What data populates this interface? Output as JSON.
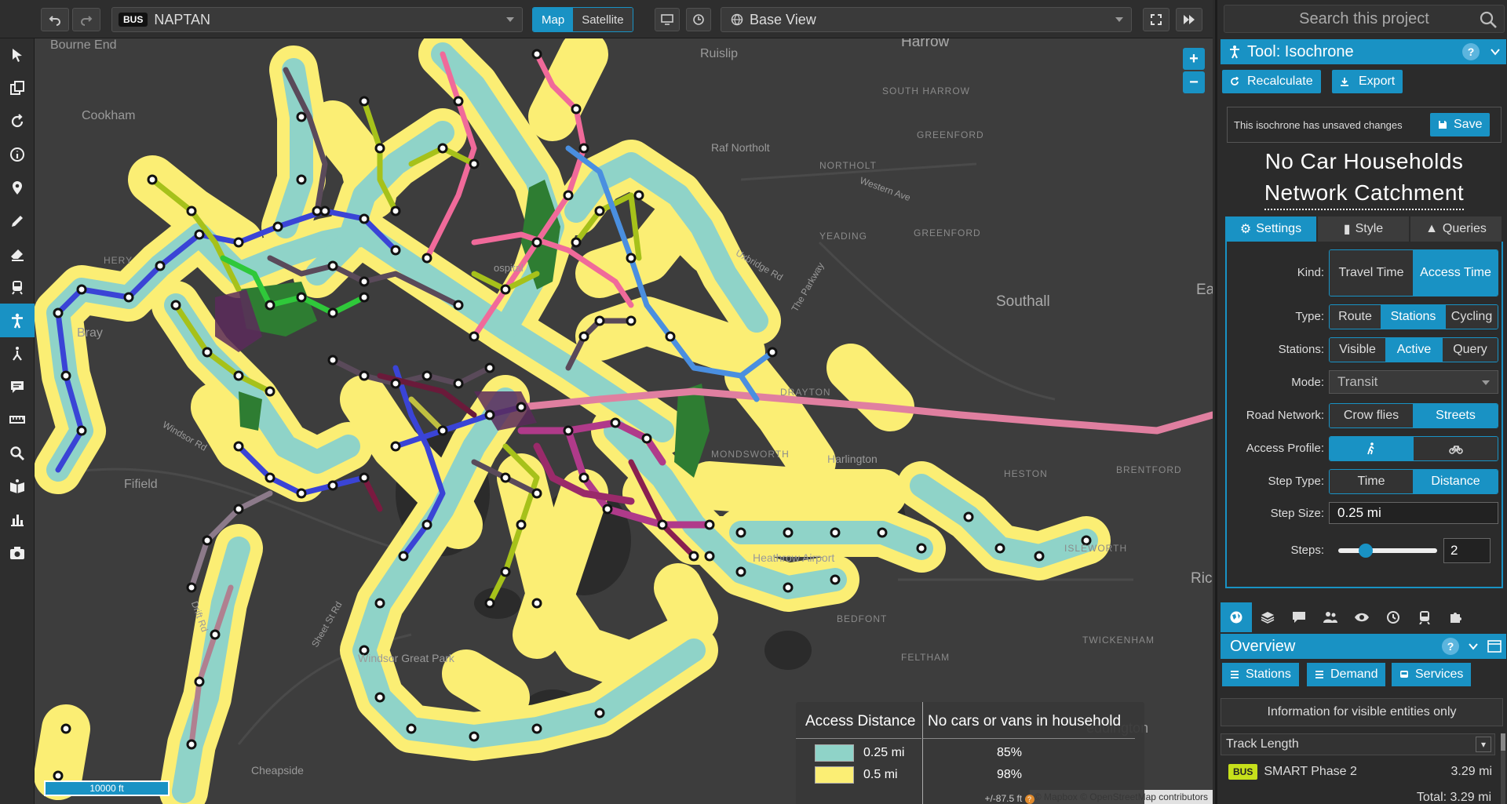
{
  "topbar": {
    "undo_icon": "undo-icon",
    "redo_icon": "redo-icon",
    "layer_badge": "BUS",
    "layer_name": "NAPTAN",
    "map_mode": [
      "Map",
      "Satellite"
    ],
    "map_mode_selected": "Map",
    "view_name": "Base View",
    "fullscreen_icon": "fullscreen-icon",
    "forward_icon": "fast-forward-icon"
  },
  "lefttools": [
    "select-arrow-icon",
    "copy-icon",
    "rotate-icon",
    "info-icon",
    "pin-icon",
    "pencil-icon",
    "eraser-icon",
    "train-icon",
    "person-icon",
    "merge-icon",
    "comment-icon",
    "ruler-icon",
    "search-icon",
    "book-icon",
    "bar-chart-icon",
    "camera-icon"
  ],
  "map": {
    "labels": {
      "harrow": "Harrow",
      "ruislip": "Ruislip",
      "bourne_end": "Bourne End",
      "cookham": "Cookham",
      "raf_northolt": "Raf Northolt",
      "south_harrow": "SOUTH HARROW",
      "greenford_small": "GREENFORD",
      "northolt": "NORTHOLT",
      "western_ave": "Western Ave",
      "yeading": "YEADING",
      "greenford2": "GREENFORD",
      "uxbridge_rd": "Uxbridge Rd",
      "the_parkway": "The Parkway",
      "southall": "Southall",
      "ea": "Ea",
      "harlington": "Harlington",
      "heston": "HESTON",
      "brentford": "BRENTFORD",
      "fifield": "Fifield",
      "windsor_rd": "Windsor Rd",
      "heathrow": "Heathrow Airport",
      "isleworth": "ISLEWORTH",
      "ric": "Ric",
      "bedfont": "BEDFONT",
      "twickenham": "TWICKENHAM",
      "feltham": "FELTHAM",
      "windsor_great_park": "Windsor Great Park",
      "eddington": "eddington",
      "cheapside": "Cheapside",
      "drift_rd": "Drift Rd",
      "sheet_st_rd": "Sheet St Rd",
      "bray": "Bray",
      "hery": "HERY",
      "ospital": "ospital",
      "monsworth": "MONDSWORTH",
      "drayton": "DRAYTON"
    },
    "zoom_in": "+",
    "zoom_out": "−",
    "scale": "10000 ft",
    "attribution": "© Mapbox © OpenStreetMap contributors"
  },
  "legend": {
    "header_a": "Access Distance",
    "header_b": "No cars or vans in household",
    "rows": [
      {
        "label": "0.25 mi",
        "value": "85%",
        "color": "#8fd3c8"
      },
      {
        "label": "0.5 mi",
        "value": "98%",
        "color": "#fbee74"
      }
    ],
    "note": "+/-87.5 ft"
  },
  "panel": {
    "search_placeholder": "Search this project",
    "tool_title": "Tool: Isochrone",
    "recalculate": "Recalculate",
    "export": "Export",
    "unsaved_msg": "This isochrone has unsaved changes",
    "save": "Save",
    "title_line1": "No Car Households",
    "title_line2": "Network Catchment",
    "tabs": [
      "Settings",
      "Style",
      "Queries"
    ],
    "settings": {
      "kind_label": "Kind:",
      "kind_opts": [
        "Travel Time",
        "Access Time"
      ],
      "type_label": "Type:",
      "type_opts": [
        "Route",
        "Stations",
        "Cycling"
      ],
      "stations_label": "Stations:",
      "stations_opts": [
        "Visible",
        "Active",
        "Query"
      ],
      "mode_label": "Mode:",
      "mode_value": "Transit",
      "road_label": "Road Network:",
      "road_opts": [
        "Crow flies",
        "Streets"
      ],
      "profile_label": "Access Profile:",
      "profile_opts": [
        "walk-icon",
        "bike-icon"
      ],
      "steptype_label": "Step Type:",
      "steptype_opts": [
        "Time",
        "Distance"
      ],
      "stepsize_label": "Step Size:",
      "stepsize_value": "0.25 mi",
      "steps_label": "Steps:",
      "steps_value": "2",
      "steps_slider_fraction": 0.2
    },
    "icon_tabs": [
      "globe-icon",
      "layers-icon",
      "comment-icon",
      "people-icon",
      "eye-icon",
      "history-icon",
      "train-icon",
      "puzzle-icon"
    ],
    "overview_title": "Overview",
    "overview_btns": [
      "Stations",
      "Demand",
      "Services"
    ],
    "visible_info": "Information for visible entities only",
    "track_length_label": "Track Length",
    "track_badge": "BUS",
    "track_name": "SMART Phase 2",
    "track_value": "3.29 mi",
    "total_label": "Total:",
    "total_value": "3.29 mi"
  },
  "colors": {
    "accent": "#1992c4",
    "catchment_inner": "#8fd3c8",
    "catchment_outer": "#fbee74",
    "map_bg": "#3d3d3d"
  }
}
